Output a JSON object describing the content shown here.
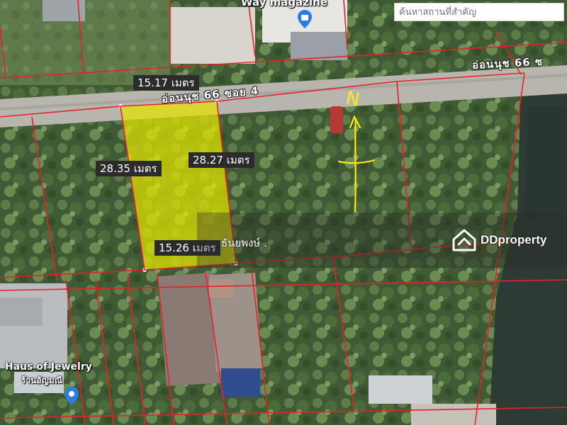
{
  "search": {
    "placeholder": "ค้นหาสถานที่สำคัญ"
  },
  "pois": [
    {
      "name": "Way magazine"
    },
    {
      "name": "Haus of Jewelry",
      "subtitle": "ร้านอัญมณี"
    }
  ],
  "roads": {
    "main": "อ่อนนุช 66 ซอย 4",
    "side": "อ่อนนุช 66 ซ"
  },
  "plot": {
    "top_edge": "15.17 เมตร",
    "left_edge": "28.35 เมตร",
    "right_edge": "28.27 เมตร",
    "bottom_edge": "15.26 เมตร"
  },
  "annotation": {
    "north_letter": "N"
  },
  "watermark": {
    "owner": "ธันยพงษ์ .",
    "brand": "DDproperty"
  },
  "colors": {
    "plot_fill": "#e3e400",
    "boundary": "#e8202a",
    "annotation": "#ffe81a",
    "water": "#2e3b35"
  }
}
